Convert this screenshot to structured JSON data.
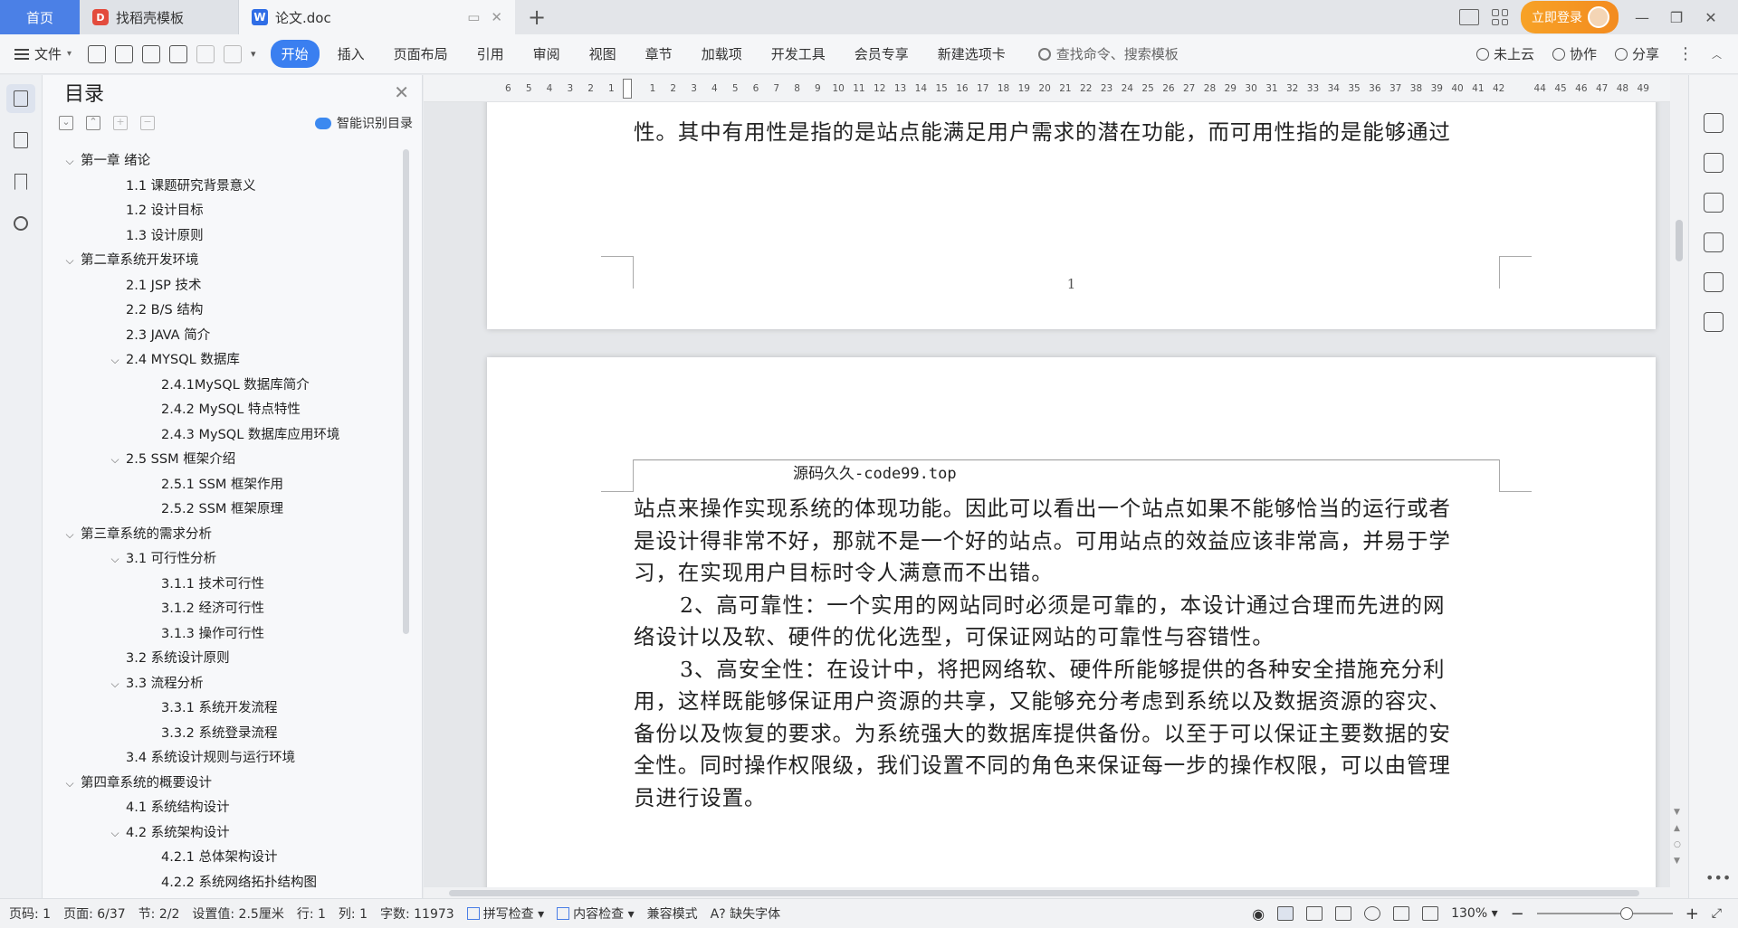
{
  "tabs": {
    "home": "首页",
    "template": "找稻壳模板",
    "doc": "论文.doc",
    "add": "+"
  },
  "titlebar": {
    "login": "立即登录",
    "minimize": "—",
    "restore": "❐",
    "close": "✕"
  },
  "toolbar": {
    "file": "文件",
    "menu_tabs": [
      "开始",
      "插入",
      "页面布局",
      "引用",
      "审阅",
      "视图",
      "章节",
      "加载项",
      "开发工具",
      "会员专享",
      "新建选项卡"
    ],
    "search_placeholder": "查找命令、搜索模板",
    "cloud": "未上云",
    "collab": "协作",
    "share": "分享"
  },
  "toc": {
    "title": "目录",
    "smart": "智能识别目录",
    "items": [
      {
        "level": 1,
        "caret": true,
        "text": "第一章  绪论"
      },
      {
        "level": 2,
        "text": "1.1 课题研究背景意义"
      },
      {
        "level": 2,
        "text": "1.2 设计目标"
      },
      {
        "level": 2,
        "text": "1.3  设计原则"
      },
      {
        "level": 1,
        "caret": true,
        "text": "第二章系统开发环境"
      },
      {
        "level": 2,
        "text": "2.1 JSP 技术"
      },
      {
        "level": 2,
        "text": "2.2 B/S 结构"
      },
      {
        "level": 2,
        "text": "2.3 JAVA 简介"
      },
      {
        "level": 2,
        "caret": true,
        "text": "2.4 MYSQL 数据库"
      },
      {
        "level": 3,
        "text": "2.4.1MySQL 数据库简介"
      },
      {
        "level": 3,
        "text": "2.4.2 MySQL 特点特性"
      },
      {
        "level": 3,
        "text": "2.4.3 MySQL 数据库应用环境"
      },
      {
        "level": 2,
        "caret": true,
        "text": "2.5 SSM 框架介绍"
      },
      {
        "level": 3,
        "text": "2.5.1 SSM 框架作用"
      },
      {
        "level": 3,
        "text": "2.5.2 SSM 框架原理"
      },
      {
        "level": 1,
        "caret": true,
        "text": "第三章系统的需求分析"
      },
      {
        "level": 2,
        "caret": true,
        "text": "3.1 可行性分析"
      },
      {
        "level": 3,
        "text": "3.1.1  技术可行性"
      },
      {
        "level": 3,
        "text": "3.1.2 经济可行性"
      },
      {
        "level": 3,
        "text": "3.1.3 操作可行性"
      },
      {
        "level": 2,
        "text": "3.2 系统设计原则"
      },
      {
        "level": 2,
        "caret": true,
        "text": "3.3 流程分析"
      },
      {
        "level": 3,
        "text": "3.3.1  系统开发流程"
      },
      {
        "level": 3,
        "text": "3.3.2  系统登录流程"
      },
      {
        "level": 2,
        "text": "3.4 系统设计规则与运行环境"
      },
      {
        "level": 1,
        "caret": true,
        "text": "第四章系统的概要设计"
      },
      {
        "level": 2,
        "text": "4.1  系统结构设计"
      },
      {
        "level": 2,
        "caret": true,
        "text": "4.2  系统架构设计"
      },
      {
        "level": 3,
        "text": "4.2.1 总体架构设计"
      },
      {
        "level": 3,
        "text": "4.2.2 系统网络拓扑结构图"
      }
    ]
  },
  "ruler": {
    "left_numbers": [
      "6",
      "5",
      "4",
      "3",
      "2",
      "1"
    ],
    "right_numbers": [
      "1",
      "2",
      "3",
      "4",
      "5",
      "6",
      "7",
      "8",
      "9",
      "10",
      "11",
      "12",
      "13",
      "14",
      "15",
      "16",
      "17",
      "18",
      "19",
      "20",
      "21",
      "22",
      "23",
      "24",
      "25",
      "26",
      "27",
      "28",
      "29",
      "30",
      "31",
      "32",
      "33",
      "34",
      "35",
      "36",
      "37",
      "38",
      "39",
      "40",
      "41",
      "42",
      "",
      "44",
      "45",
      "46",
      "47",
      "48",
      "49"
    ]
  },
  "document": {
    "page1_lines": [
      "性。其中有用性是指的是站点能满足用户需求的潜在功能，而可用性指的是能够通过"
    ],
    "page1_number": "1",
    "page2_header": "源码久久-code99.top",
    "page2_lines": [
      {
        "indent": false,
        "text": "站点来操作实现系统的体现功能。因此可以看出一个站点如果不能够恰当的运行或者"
      },
      {
        "indent": false,
        "text": "是设计得非常不好，那就不是一个好的站点。可用站点的效益应该非常高，并易于学"
      },
      {
        "indent": false,
        "text": "习，在实现用户目标时令人满意而不出错。"
      },
      {
        "indent": true,
        "text": "2、高可靠性：一个实用的网站同时必须是可靠的，本设计通过合理而先进的网"
      },
      {
        "indent": false,
        "text": "络设计以及软、硬件的优化选型，可保证网站的可靠性与容错性。"
      },
      {
        "indent": true,
        "text": "3、高安全性：在设计中，将把网络软、硬件所能够提供的各种安全措施充分利"
      },
      {
        "indent": false,
        "text": "用，这样既能够保证用户资源的共享，又能够充分考虑到系统以及数据资源的容灾、"
      },
      {
        "indent": false,
        "text": "备份以及恢复的要求。为系统强大的数据库提供备份。以至于可以保证主要数据的安"
      },
      {
        "indent": false,
        "text": "全性。同时操作权限级，我们设置不同的角色来保证每一步的操作权限，可以由管理"
      },
      {
        "indent": false,
        "text": "员进行设置。"
      }
    ]
  },
  "status": {
    "page_no": "页码: 1",
    "page": "页面: 6/37",
    "section": "节: 2/2",
    "setting": "设置值: 2.5厘米",
    "row": "行: 1",
    "col": "列: 1",
    "words": "字数: 11973",
    "spell": "拼写检查",
    "content_check": "内容检查",
    "compat": "兼容模式",
    "missing_font": "缺失字体",
    "zoom": "130%"
  }
}
